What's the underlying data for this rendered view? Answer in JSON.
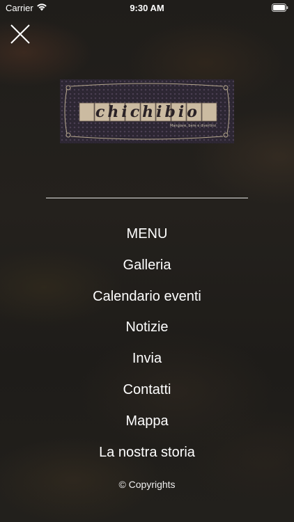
{
  "status_bar": {
    "carrier": "Carrier",
    "time": "9:30 AM"
  },
  "logo": {
    "brand": "chichibio",
    "tagline": "Mangiare, bere e divertirsi"
  },
  "menu": {
    "items": [
      {
        "label": "MENU"
      },
      {
        "label": "Galleria"
      },
      {
        "label": "Calendario eventi"
      },
      {
        "label": "Notizie"
      },
      {
        "label": "Invia"
      },
      {
        "label": "Contatti"
      },
      {
        "label": "Mappa"
      },
      {
        "label": "La nostra storia"
      }
    ]
  },
  "footer": {
    "copyright": "© Copyrights"
  },
  "colors": {
    "text": "#ffffff",
    "background": "#1f1d1a",
    "logo_tiles": "#c9b9a0",
    "logo_frame": "#2a2430"
  }
}
